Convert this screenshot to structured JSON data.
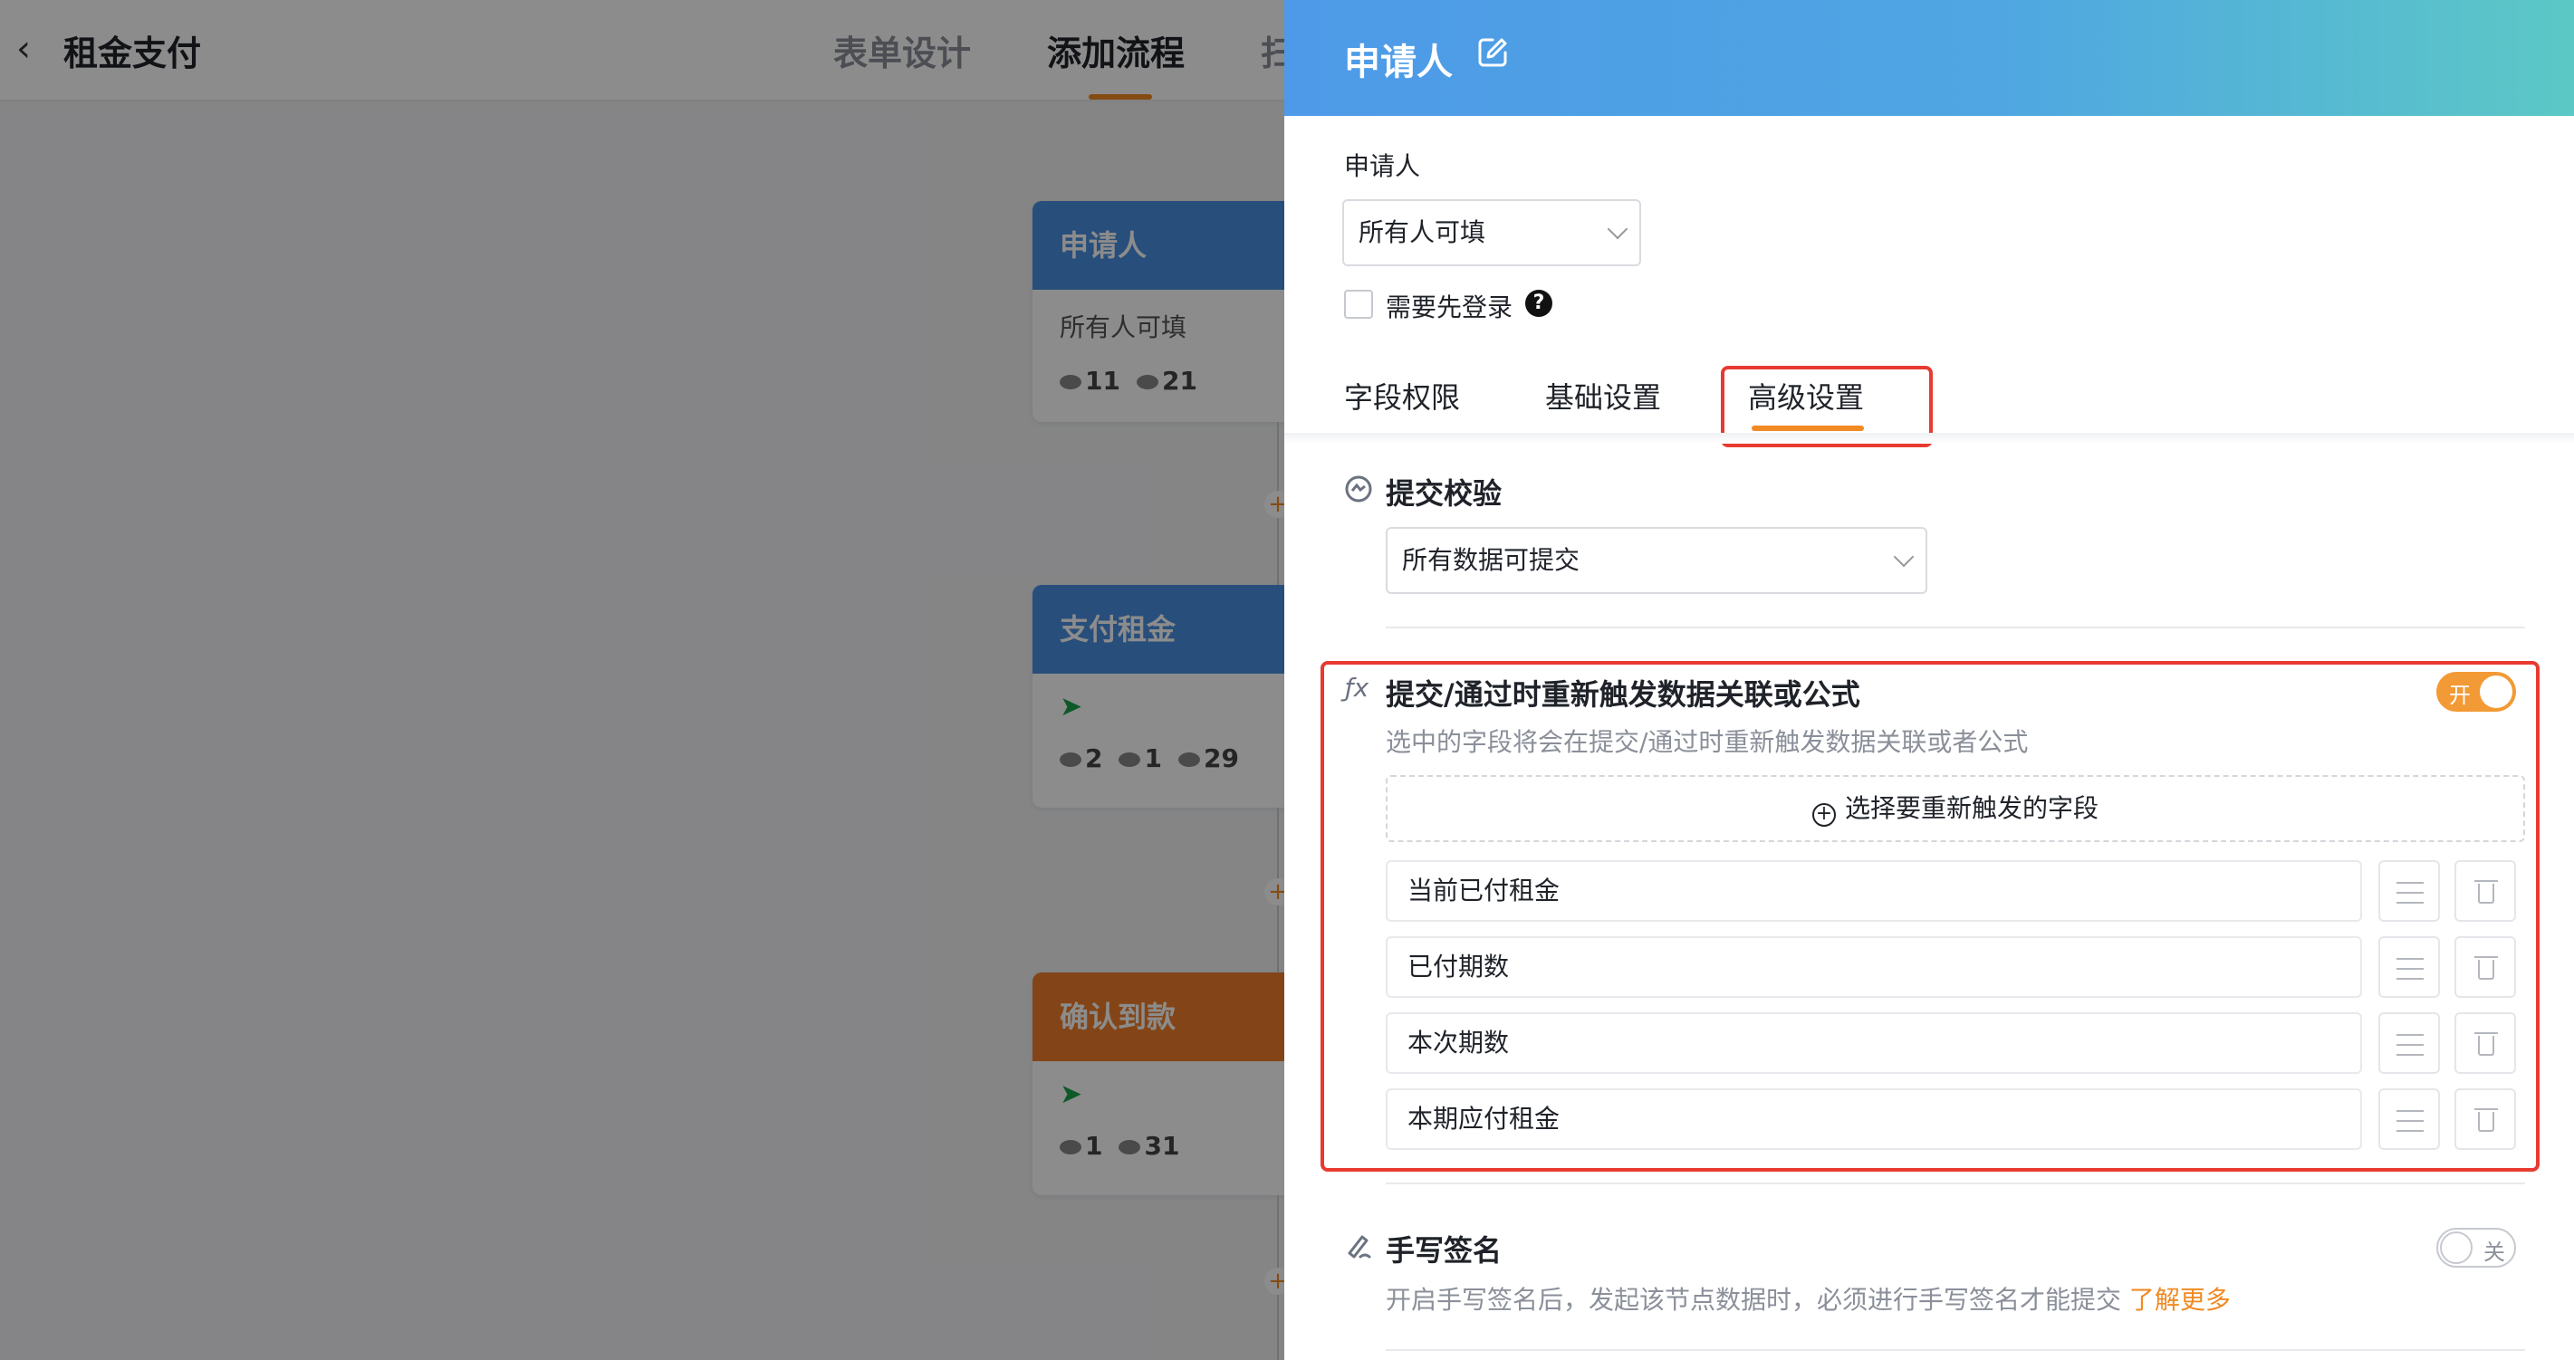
{
  "app": {
    "back_glyph": "‹",
    "title": "租金支付",
    "tabs": [
      "表单设计",
      "添加流程",
      "扫"
    ]
  },
  "flow": {
    "cards": [
      {
        "title": "申请人",
        "subtitle": "所有人可填",
        "stats": [
          "11",
          "21"
        ],
        "color": "#4a8fe0"
      },
      {
        "title": "支付租金",
        "subtitle": "",
        "stats": [
          "2",
          "1",
          "29"
        ],
        "color": "#4a8fe0"
      },
      {
        "title": "确认到款",
        "subtitle": "",
        "stats": [
          "1",
          "31"
        ],
        "color": "#ef7f2b"
      }
    ],
    "plus_glyph": "+"
  },
  "drawer": {
    "title": "申请人",
    "applicant_label": "申请人",
    "applicant_select": "所有人可填",
    "login_label": "需要先登录",
    "help_glyph": "?",
    "tabs": [
      "字段权限",
      "基础设置",
      "高级设置"
    ],
    "active_tab": "高级设置",
    "submit_check": {
      "title": "提交校验",
      "select": "所有数据可提交"
    },
    "retrigger": {
      "icon_text": "ƒx",
      "title": "提交/通过时重新触发数据关联或公式",
      "desc": "选中的字段将会在提交/通过时重新触发数据关联或者公式",
      "toggle_label": "开",
      "add_field_label": "选择要重新触发的字段",
      "add_glyph": "+",
      "fields": [
        "当前已付租金",
        "已付期数",
        "本次期数",
        "本期应付租金"
      ]
    },
    "signature": {
      "title": "手写签名",
      "desc": "开启手写签名后，发起该节点数据时，必须进行手写签名才能提交",
      "learn_more": "了解更多",
      "toggle_label": "关"
    }
  },
  "colors": {
    "accent": "#f08a24",
    "highlight_red": "#e83a30",
    "header_gradient_start": "#4e9ae8",
    "header_gradient_end": "#5cc8c6"
  }
}
